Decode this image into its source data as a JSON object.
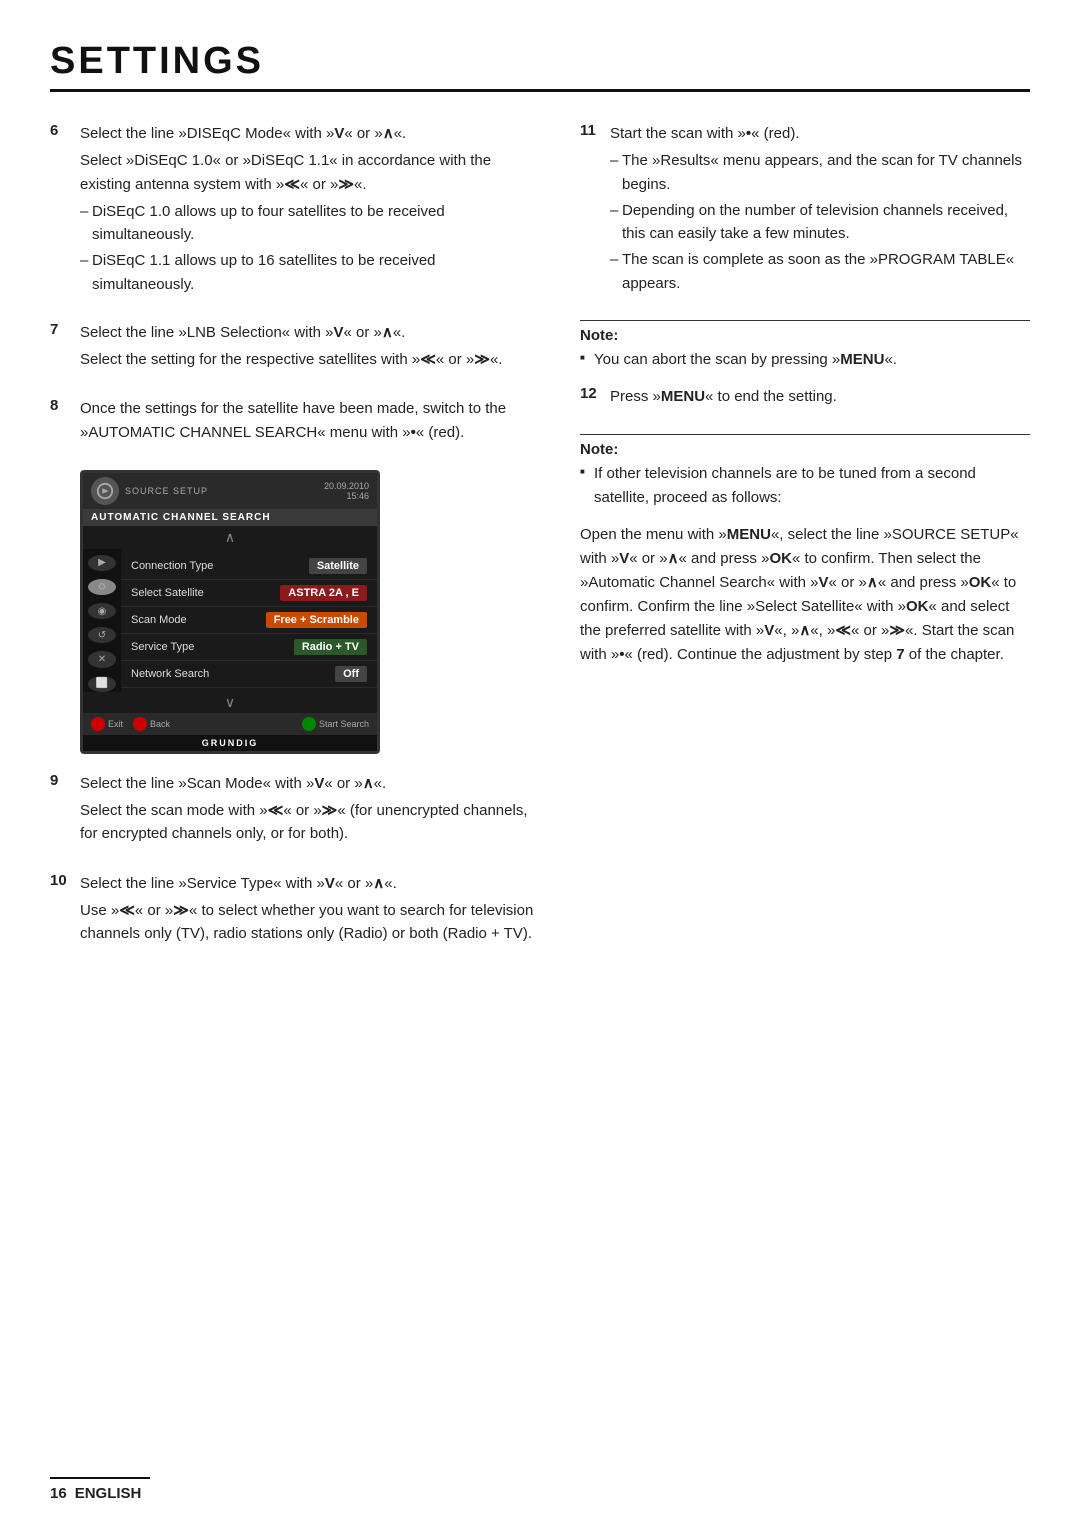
{
  "page": {
    "title": "SETTINGS",
    "footer_num": "16",
    "footer_lang": "ENGLISH"
  },
  "left_column": {
    "steps": [
      {
        "num": "6",
        "text": "Select the line »DISEqC Mode« with »V« or »∧«.",
        "sub": "Select »DiSEqC 1.0« or »DiSEqC 1.1« in accordance with the existing antenna system with »≪« or »≫«.",
        "bullets": [
          "DiSEqC 1.0 allows up to four satellites to be received simultaneously.",
          "DiSEqC 1.1 allows up to 16 satellites to be received simultaneously."
        ]
      },
      {
        "num": "7",
        "text": "Select the line »LNB Selection« with »V« or »∧«.",
        "sub": "Select the setting for the respective satellites with »≪« or »≫«."
      },
      {
        "num": "8",
        "text": "Once the settings for the satellite have been made, switch to the »AUTOMATIC CHANNEL SEARCH« menu with »•«  (red)."
      }
    ],
    "tv": {
      "source_label": "SOURCE SETUP",
      "date": "20.09.2010",
      "time": "15:46",
      "title": "AUTOMATIC CHANNEL SEARCH",
      "arrow_up": "∧",
      "rows": [
        {
          "label": "Connection Type",
          "value": "Satellite",
          "style": "dark-gray"
        },
        {
          "label": "Select Satellite",
          "value": "ASTRA 2A , E",
          "style": "dark-red"
        },
        {
          "label": "Scan Mode",
          "value": "Free + Scramble",
          "style": "orange"
        },
        {
          "label": "Service Type",
          "value": "Radio + TV",
          "style": "dark-green"
        },
        {
          "label": "Network Search",
          "value": "Off",
          "style": "dark-gray"
        }
      ],
      "arrow_down": "∨",
      "sidebar_icons": [
        "▶",
        "⚙",
        "◉",
        "↺",
        "✕",
        "⬜"
      ],
      "bottom_buttons": [
        {
          "color": "red",
          "label": "Exit"
        },
        {
          "color": "red",
          "label": "Back"
        },
        {
          "color": "green",
          "label": "Start Search"
        }
      ],
      "brand": "GRUNDIG"
    },
    "steps2": [
      {
        "num": "9",
        "text": "Select the line »Scan Mode« with »V« or »∧«.",
        "sub": "Select the scan mode with »≪« or »≫« (for unencrypted channels, for encrypted channels only, or for both)."
      },
      {
        "num": "10",
        "text": "Select the line »Service Type« with »V« or »∧«.",
        "sub": "Use »≪« or »≫« to select whether you want to search for television channels only (TV), radio stations only (Radio) or both (Radio + TV)."
      }
    ]
  },
  "right_column": {
    "steps": [
      {
        "num": "11",
        "text": "Start the scan with »•« (red).",
        "bullets": [
          "The »Results« menu appears, and the scan for TV channels begins.",
          "Depending on the number of television channels received, this can easily take a few minutes.",
          "The scan is complete as soon as the »PROGRAM TABLE« appears."
        ]
      }
    ],
    "note1": {
      "title": "Note:",
      "content": "You can abort the scan by pressing »MENU«."
    },
    "steps2": [
      {
        "num": "12",
        "text": "Press »MENU« to end the setting."
      }
    ],
    "note2": {
      "title": "Note:",
      "content": "If other television channels are to be tuned from a second satellite, proceed as follows:"
    },
    "extra_text": [
      "Open the menu with »MENU«, select the line »SOURCE SETUP« with »V« or »∧« and press »OK« to confirm. Then select the »Automatic Channel Search« with »V« or »∧« and press »OK« to confirm. Confirm the line »Select Satellite« with »OK« and select the preferred satellite with »V«, »∧«, »≪« or »≫«. Start the scan with »•« (red). Continue the adjustment by step 7 of the chapter."
    ]
  }
}
